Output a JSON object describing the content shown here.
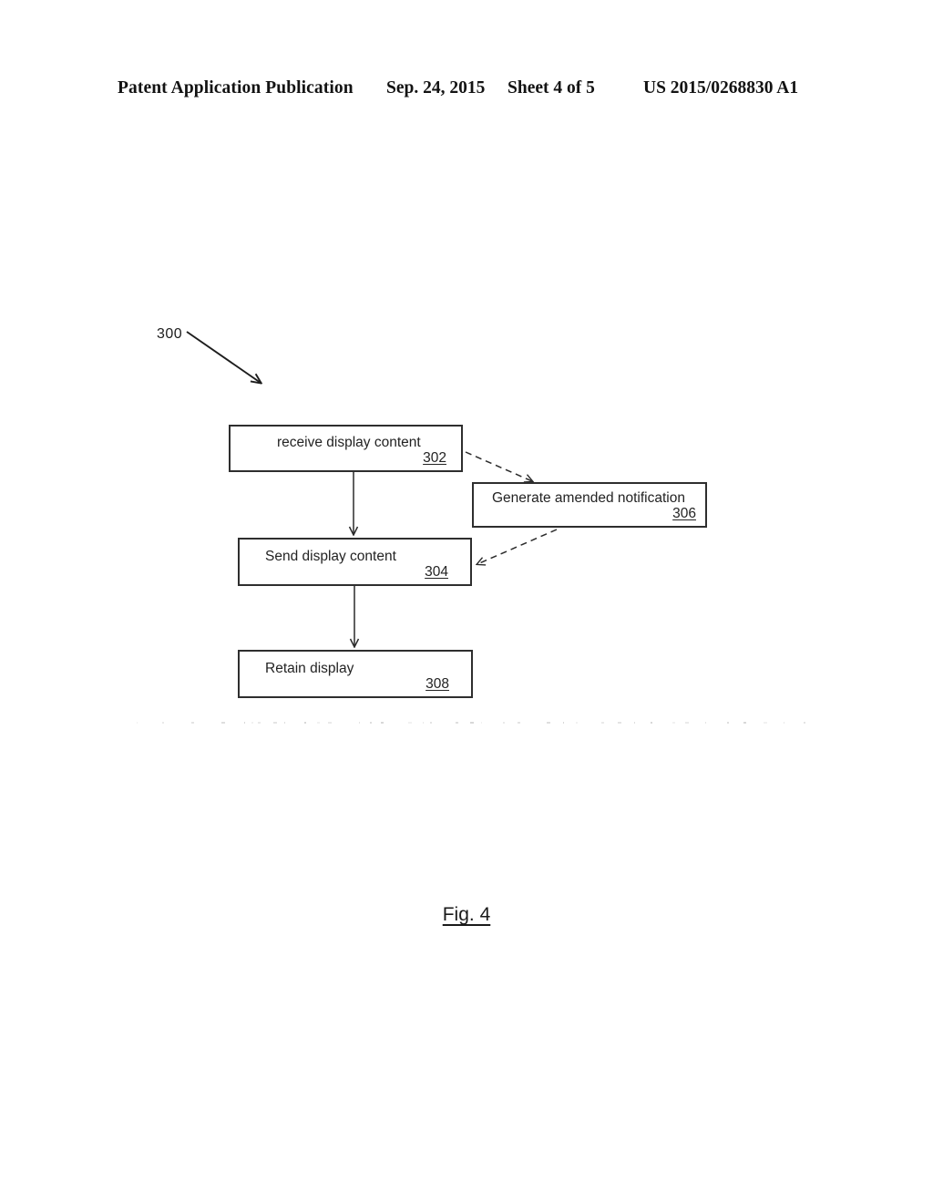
{
  "header": {
    "publication": "Patent Application Publication",
    "date": "Sep. 24, 2015",
    "sheet": "Sheet 4 of 5",
    "patent_number": "US 2015/0268830 A1"
  },
  "figure": {
    "caption": "Fig. 4",
    "diagram_reference": "300"
  },
  "flowchart": {
    "nodes": [
      {
        "id": "302",
        "label": "receive display content",
        "ref": "302"
      },
      {
        "id": "306",
        "label": "Generate amended notification",
        "ref": "306"
      },
      {
        "id": "304",
        "label": "Send display content",
        "ref": "304"
      },
      {
        "id": "308",
        "label": "Retain display",
        "ref": "308"
      }
    ],
    "connectors": [
      {
        "from": "302",
        "to": "304",
        "style": "solid",
        "direction": "down"
      },
      {
        "from": "302",
        "to": "306",
        "style": "dashed",
        "direction": "down-right"
      },
      {
        "from": "306",
        "to": "304",
        "style": "dashed",
        "direction": "down-left"
      },
      {
        "from": "304",
        "to": "308",
        "style": "solid",
        "direction": "down"
      },
      {
        "from": "300",
        "to": "diagram",
        "style": "solid-leader",
        "direction": "down-right"
      }
    ]
  },
  "colors": {
    "ink": "#1d1d1d",
    "box_border": "#2e2e2e",
    "page_background": "#ffffff"
  }
}
